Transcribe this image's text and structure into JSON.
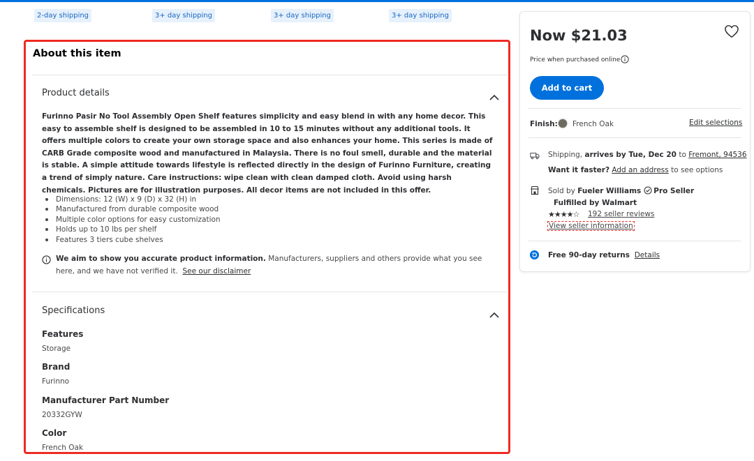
{
  "colors": {
    "accent": "#0071dc",
    "highlight_border": "#ee2a24",
    "badge_bg": "#e6f1fc"
  },
  "shipping_badges": [
    "2-day shipping",
    "3+ day shipping",
    "3+ day shipping",
    "3+ day shipping"
  ],
  "about": {
    "title": "About this item",
    "product_details": {
      "heading": "Product details",
      "description": "Furinno Pasir No Tool Assembly Open Shelf features simplicity and easy blend in with any home decor. This easy to assemble shelf is designed to be assembled in 10 to 15 minutes without any additional tools. It offers multiple colors to create your own storage space and also enhances your home. This series is made of CARB Grade composite wood and manufactured in Malaysia. There is no foul smell, durable and the material is stable. A simple attitude towards lifestyle is reflected directly in the design of Furinno Furniture, creating a trend of simply nature. Care instructions: wipe clean with clean damped cloth. Avoid using harsh chemicals. Pictures are for illustration purposes. All decor items are not included in this offer.",
      "bullets": [
        "Dimensions: 12 (W) x 9 (D) x 32 (H) in",
        "Manufactured from durable composite wood",
        "Multiple color options for easy customization",
        "Holds up to 10 lbs per shelf",
        "Features 3 tiers cube shelves"
      ],
      "disclaimer_bold": "We aim to show you accurate product information.",
      "disclaimer_text": " Manufacturers, suppliers and others provide what you see here, and we have not verified it.",
      "disclaimer_link": "See our disclaimer"
    },
    "specifications": {
      "heading": "Specifications",
      "items": [
        {
          "name": "Features",
          "value": "Storage"
        },
        {
          "name": "Brand",
          "value": "Furinno"
        },
        {
          "name": "Manufacturer Part Number",
          "value": "20332GYW"
        },
        {
          "name": "Color",
          "value": "French Oak"
        }
      ]
    }
  },
  "buybox": {
    "price": "Now $21.03",
    "price_note": "Price when purchased online",
    "add_to_cart": "Add to cart",
    "finish_label": "Finish:",
    "finish_value": "French Oak",
    "edit_selections": "Edit selections",
    "shipping_prefix": "Shipping, ",
    "shipping_bold": "arrives by Tue, Dec 20",
    "shipping_to": " to ",
    "shipping_location": "Fremont, 94536",
    "faster_bold": "Want it faster?",
    "faster_link": "Add an address",
    "faster_suffix": " to see options",
    "sold_by_prefix": "Sold by ",
    "seller_name": "Fueler Williams",
    "pro_seller": "Pro Seller",
    "fulfilled_by": "Fulfilled by Walmart",
    "rating_stars": 4,
    "stars_text": "★★★★☆",
    "reviews": "192 seller reviews",
    "view_seller": "View seller information",
    "returns_bold": "Free 90-day returns",
    "returns_link": "Details"
  }
}
